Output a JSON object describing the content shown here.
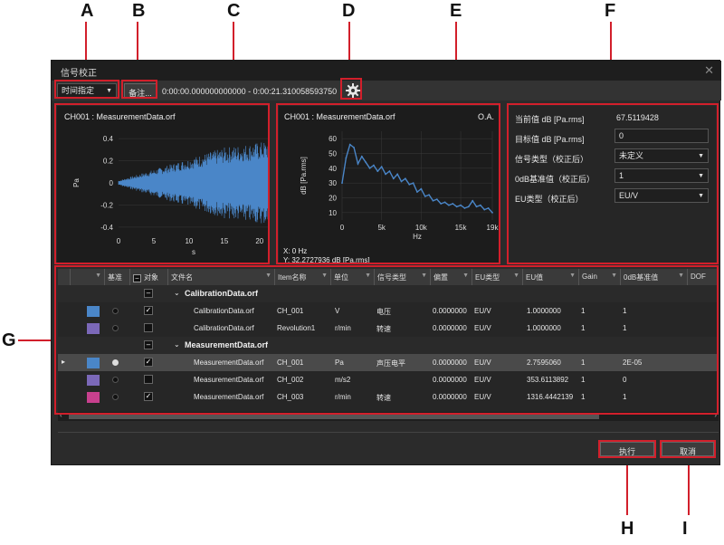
{
  "callouts": [
    "A",
    "B",
    "C",
    "D",
    "E",
    "F",
    "G",
    "H",
    "I"
  ],
  "window": {
    "title": "信号校正"
  },
  "toolbar": {
    "mode_select": "时间指定",
    "note_button": "备注...",
    "time_range": "0:00:00.000000000000 - 0:00:21.310058593750"
  },
  "waveform_panel": {
    "title": "CH001 : MeasurementData.orf",
    "ylabel": "Pa",
    "xlabel": "s",
    "yticks": [
      "0.4",
      "0.2",
      "0",
      "-0.2",
      "-0.4"
    ],
    "xticks": [
      "0",
      "5",
      "10",
      "15",
      "20"
    ]
  },
  "spectrum_panel": {
    "title": "CH001 : MeasurementData.orf",
    "badge": "O.A.",
    "ylabel": "dB [Pa.rms]",
    "xlabel": "Hz",
    "yticks": [
      "60",
      "50",
      "40",
      "30",
      "20",
      "10"
    ],
    "xticks": [
      "0",
      "5k",
      "10k",
      "15k",
      "19k"
    ],
    "cursor_x": "X: 0 Hz",
    "cursor_y": "Y: 32.2727936 dB [Pa.rms]"
  },
  "settings": {
    "current_label": "当前值 dB [Pa.rms]",
    "current_value": "67.5119428",
    "target_label": "目标值 dB [Pa.rms]",
    "target_value": "0",
    "signal_type_label": "信号类型（校正后）",
    "signal_type_value": "未定义",
    "zero_db_label": "0dB基准值（校正后）",
    "zero_db_value": "1",
    "eu_type_label": "EU类型（校正后）",
    "eu_type_value": "EU/V"
  },
  "grid": {
    "columns": [
      "基准",
      "对象",
      "文件名",
      "Item名称",
      "单位",
      "信号类型",
      "偏置",
      "EU类型",
      "EU值",
      "Gain",
      "0dB基准值",
      "DOF"
    ],
    "groups": [
      {
        "name": "CalibrationData.orf",
        "rows": [
          {
            "color": "#4a86c8",
            "ref": false,
            "target": true,
            "file": "CalibrationData.orf",
            "item": "CH_001",
            "unit": "V",
            "signal": "电压",
            "offset": "0.0000000",
            "eu_type": "EU/V",
            "eu": "1.0000000",
            "gain": "1",
            "zero_db": "1"
          },
          {
            "color": "#7b68b8",
            "ref": false,
            "target": false,
            "file": "CalibrationData.orf",
            "item": "Revolution1",
            "unit": "r/min",
            "signal": "转速",
            "offset": "0.0000000",
            "eu_type": "EU/V",
            "eu": "1.0000000",
            "gain": "1",
            "zero_db": "1"
          }
        ]
      },
      {
        "name": "MeasurementData.orf",
        "rows": [
          {
            "color": "#4a86c8",
            "ref": true,
            "target": true,
            "file": "MeasurementData.orf",
            "item": "CH_001",
            "unit": "Pa",
            "signal": "声压电平",
            "offset": "0.0000000",
            "eu_type": "EU/V",
            "eu": "2.7595060",
            "gain": "1",
            "zero_db": "2E-05",
            "selected": true
          },
          {
            "color": "#7b68b8",
            "ref": false,
            "target": false,
            "file": "MeasurementData.orf",
            "item": "CH_002",
            "unit": "m/s2",
            "signal": "",
            "offset": "0.0000000",
            "eu_type": "EU/V",
            "eu": "353.6113892",
            "gain": "1",
            "zero_db": "0"
          },
          {
            "color": "#c8408e",
            "ref": false,
            "target": true,
            "file": "MeasurementData.orf",
            "item": "CH_003",
            "unit": "r/min",
            "signal": "转速",
            "offset": "0.0000000",
            "eu_type": "EU/V",
            "eu": "1316.4442139",
            "gain": "1",
            "zero_db": "1"
          }
        ]
      }
    ]
  },
  "buttons": {
    "execute": "执行",
    "cancel": "取消"
  },
  "colors": {
    "accent": "#d21f2b",
    "signal": "#4a86c8",
    "bg": "#2b2b2b",
    "plot_bg": "#1c1c1c"
  },
  "chart_data": [
    {
      "type": "area",
      "title": "CH001 : MeasurementData.orf",
      "xlabel": "s",
      "ylabel": "Pa",
      "xlim": [
        0,
        21.31
      ],
      "ylim": [
        -0.45,
        0.45
      ],
      "series": [
        {
          "name": "",
          "envelope_x": [
            0,
            5,
            10,
            15,
            21.3
          ],
          "envelope_y": [
            0.02,
            0.12,
            0.22,
            0.32,
            0.38
          ]
        }
      ]
    },
    {
      "type": "line",
      "title": "CH001 : MeasurementData.orf",
      "xlabel": "Hz",
      "ylabel": "dB [Pa.rms]",
      "xlim": [
        0,
        19000
      ],
      "ylim": [
        5,
        65
      ],
      "series": [
        {
          "name": "",
          "x": [
            0,
            500,
            1000,
            1500,
            2000,
            2500,
            3000,
            3500,
            4000,
            4500,
            5000,
            5500,
            6000,
            6500,
            7000,
            7500,
            8000,
            8500,
            9000,
            9500,
            10000,
            10500,
            11000,
            11500,
            12000,
            12500,
            13000,
            13500,
            14000,
            14500,
            15000,
            15500,
            16000,
            16500,
            17000,
            17500,
            18000,
            18500,
            19000
          ],
          "y": [
            30,
            47,
            56,
            54,
            43,
            48,
            44,
            40,
            42,
            38,
            41,
            36,
            38,
            33,
            36,
            31,
            33,
            29,
            30,
            24,
            26,
            21,
            22,
            18,
            19,
            16,
            17,
            15,
            16,
            14,
            15,
            13,
            14,
            18,
            14,
            15,
            12,
            13,
            10
          ]
        }
      ]
    }
  ]
}
